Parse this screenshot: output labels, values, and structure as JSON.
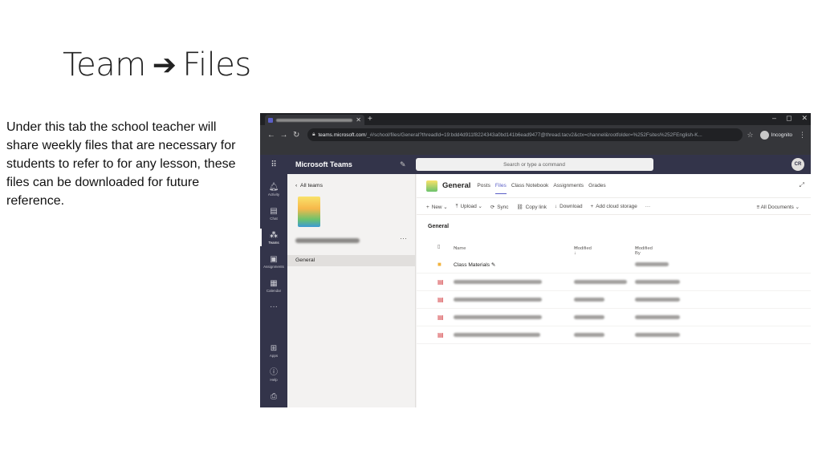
{
  "slide": {
    "title_left": "Team",
    "title_right": "Files",
    "body": "Under this tab the school teacher will share weekly files that are necessary for students to refer to for any lesson, these files can be downloaded for future reference."
  },
  "browser": {
    "url_domain": "teams.microsoft.com",
    "url_path": "/_#/school/files/General?threadId=19:bdd4d911f8224343a0bd141b6ead9477@thread.tacv2&ctx=channel&rootfolder=%252Fsites%252FEnglish-K...",
    "profile_label": "Incognito",
    "new_tab": "+",
    "window_controls": [
      "–",
      "◻",
      "✕"
    ]
  },
  "teams": {
    "app_name": "Microsoft Teams",
    "search_placeholder": "Search or type a command",
    "avatar_initials": "CR",
    "rail": [
      {
        "label": "Activity",
        "icon": "bell-icon"
      },
      {
        "label": "Chat",
        "icon": "chat-icon"
      },
      {
        "label": "Teams",
        "icon": "teams-icon"
      },
      {
        "label": "Assignments",
        "icon": "assignments-icon"
      },
      {
        "label": "Calendar",
        "icon": "calendar-icon"
      },
      {
        "label": "",
        "icon": "more-icon"
      },
      {
        "label": "Apps",
        "icon": "apps-icon"
      },
      {
        "label": "Help",
        "icon": "help-icon"
      }
    ],
    "all_teams": "All teams",
    "channel": "General",
    "content": {
      "title": "General",
      "tabs": [
        "Posts",
        "Files",
        "Class Notebook",
        "Assignments",
        "Grades"
      ],
      "active_tab": "Files",
      "toolbar": [
        "New",
        "Upload",
        "Sync",
        "Copy link",
        "Download",
        "Add cloud storage"
      ],
      "view": "All Documents",
      "section": "General",
      "columns": {
        "name": "Name",
        "modified": "Modified ↓",
        "modified_by": "Modified By"
      },
      "folder_name": "Class Materials"
    }
  }
}
